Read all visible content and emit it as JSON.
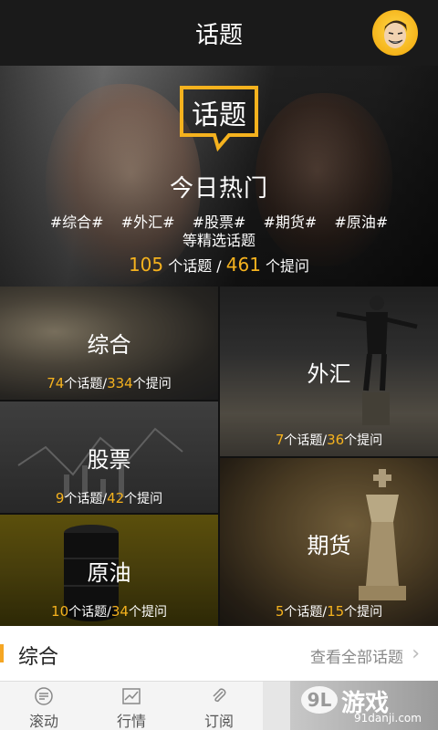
{
  "header": {
    "title": "话题"
  },
  "hero": {
    "badge_text": "话题",
    "headline": "今日热门",
    "tags": [
      "#综合#",
      "#外汇#",
      "#股票#",
      "#期货#",
      "#原油#"
    ],
    "subtitle": "等精选话题",
    "topic_count": "105",
    "topic_unit": " 个话题 / ",
    "question_count": "461",
    "question_unit": " 个提问"
  },
  "categories": [
    {
      "name": "综合",
      "topics": "74",
      "questions": "334"
    },
    {
      "name": "外汇",
      "topics": "7",
      "questions": "36"
    },
    {
      "name": "股票",
      "topics": "9",
      "questions": "42"
    },
    {
      "name": "期货",
      "topics": "5",
      "questions": "15"
    },
    {
      "name": "原油",
      "topics": "10",
      "questions": "34"
    }
  ],
  "units": {
    "topic": "个话题",
    "sep": "/",
    "question": "个提问"
  },
  "section": {
    "label": "综合",
    "view_all": "查看全部话题"
  },
  "tabs": [
    {
      "label": "滚动",
      "icon": "scroll-list-icon"
    },
    {
      "label": "行情",
      "icon": "chart-icon"
    },
    {
      "label": "订阅",
      "icon": "paperclip-icon"
    }
  ],
  "watermark": {
    "brand": "游戏",
    "badge": "9L",
    "url": "91danji.com"
  },
  "colors": {
    "accent": "#f5b21e",
    "topbar": "#1a1a1a",
    "section_accent": "#f5a623"
  }
}
